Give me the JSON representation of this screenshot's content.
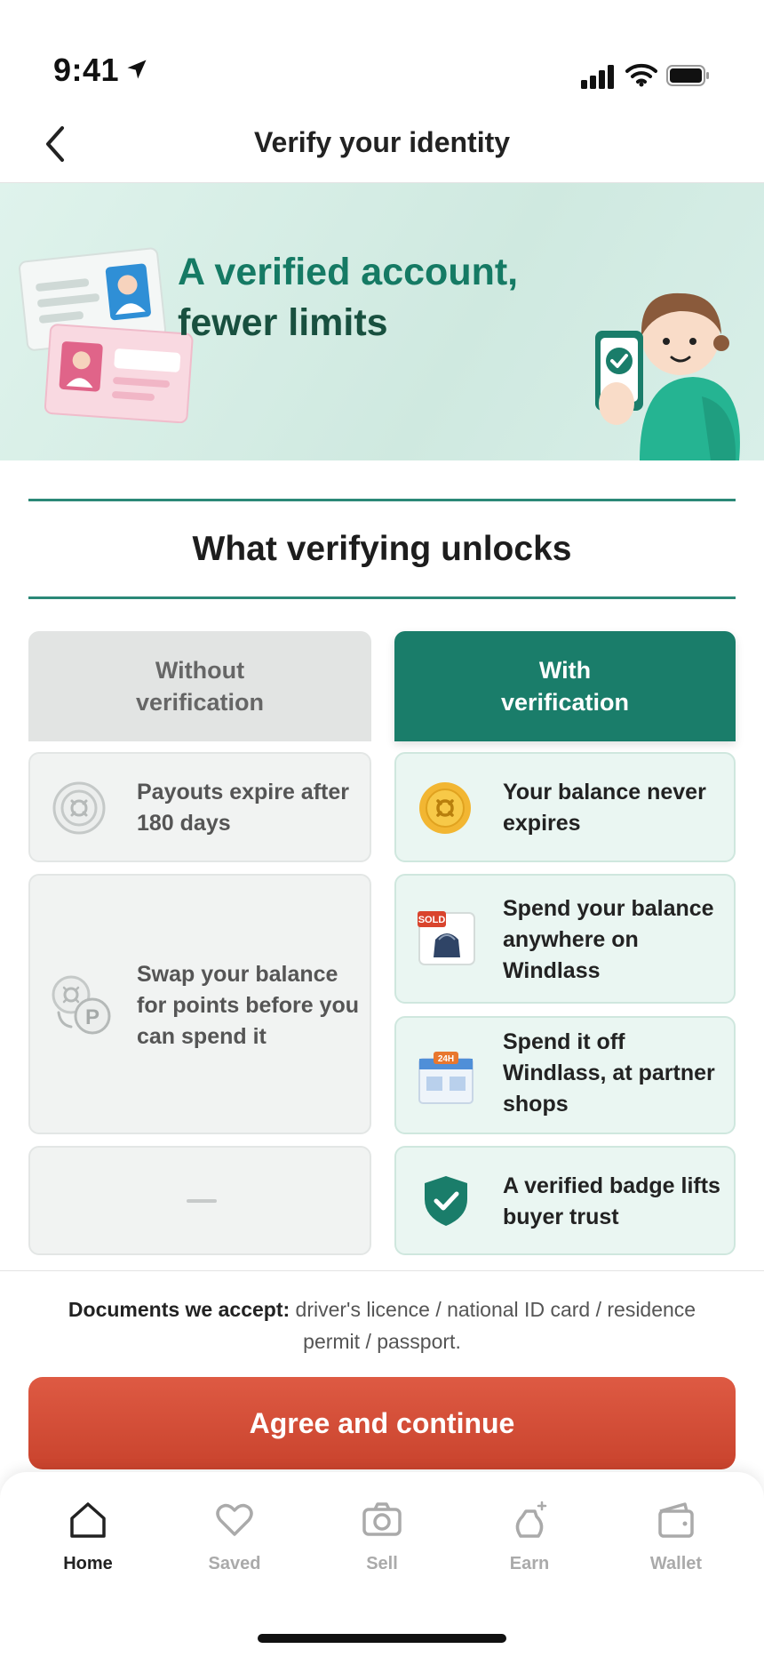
{
  "status": {
    "time": "9:41"
  },
  "nav": {
    "title": "Verify your identity"
  },
  "hero": {
    "line1": "A verified account,",
    "line2": "fewer limits"
  },
  "section": {
    "heading": "What verifying unlocks"
  },
  "columns": {
    "without": {
      "line1": "Without",
      "line2": "verification"
    },
    "with": {
      "line1": "With",
      "line2": "verification"
    }
  },
  "rows": {
    "without": [
      {
        "icon": "coin-icon",
        "text": "Payouts expire after 180 days"
      },
      {
        "icon": "coin-to-points-icon",
        "text": "Swap your balance for points before you can spend it"
      },
      {
        "icon": "dash",
        "text": "—"
      }
    ],
    "with": [
      {
        "icon": "gold-coin-icon",
        "text": "Your balance never expires"
      },
      {
        "icon": "sold-bag-icon",
        "text": "Spend your balance anywhere on Windlass",
        "badge": "SOLD"
      },
      {
        "icon": "shop-24h-icon",
        "text": "Spend it off Windlass, at partner shops",
        "badge": "24H"
      },
      {
        "icon": "verified-shield-icon",
        "text": "A verified badge lifts buyer trust"
      }
    ]
  },
  "docs": {
    "label": "Documents we accept:",
    "text": "driver's licence / national ID card / residence permit / passport."
  },
  "cta": {
    "label": "Agree and continue"
  },
  "tabs": [
    {
      "icon": "home-icon",
      "label": "Home",
      "active": true
    },
    {
      "icon": "heart-icon",
      "label": "Saved",
      "active": false
    },
    {
      "icon": "camera-icon",
      "label": "Sell",
      "active": false
    },
    {
      "icon": "sparkle-bag-icon",
      "label": "Earn",
      "active": false
    },
    {
      "icon": "wallet-icon",
      "label": "Wallet",
      "active": false
    }
  ],
  "colors": {
    "brand": "#1a7d6a",
    "cta": "#d24e37",
    "hero_bg": "#d8efe8",
    "gold": "#f2b632"
  }
}
